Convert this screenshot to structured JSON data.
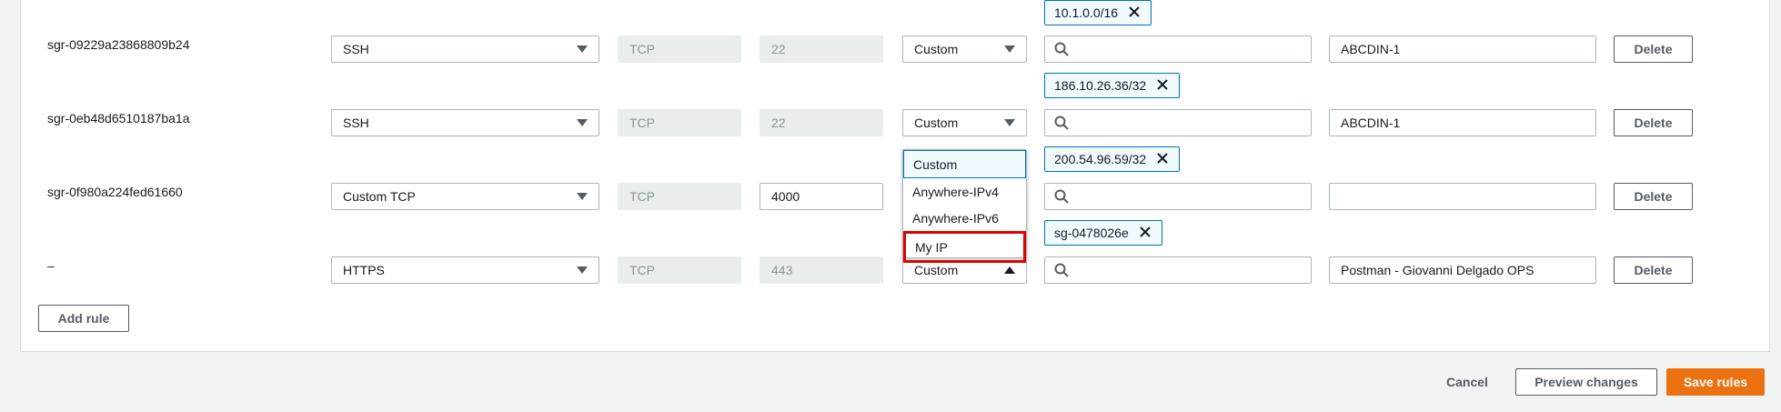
{
  "rules": [
    {
      "id": "sgr-09229a23868809b24",
      "type": "SSH",
      "protocol": "TCP",
      "port": "22",
      "source_type": "Custom",
      "token": "10.1.0.0/16",
      "description": "ABCDIN-1",
      "delete_label": "Delete"
    },
    {
      "id": "sgr-0eb48d6510187ba1a",
      "type": "SSH",
      "protocol": "TCP",
      "port": "22",
      "source_type": "Custom",
      "token": "186.10.26.36/32",
      "description": "ABCDIN-1",
      "delete_label": "Delete"
    },
    {
      "id": "sgr-0f980a224fed61660",
      "type": "Custom TCP",
      "protocol": "TCP",
      "port": "4000",
      "source_type": "Custom",
      "token": "200.54.96.59/32",
      "description": "",
      "delete_label": "Delete"
    },
    {
      "id": "–",
      "type": "HTTPS",
      "protocol": "TCP",
      "port": "443",
      "source_type": "Custom",
      "token": "sg-0478026e",
      "description": "Postman - Giovanni Delgado OPS",
      "delete_label": "Delete"
    }
  ],
  "source_dropdown": {
    "options": [
      "Custom",
      "Anywhere-IPv4",
      "Anywhere-IPv6",
      "My IP"
    ],
    "selected": "Custom",
    "highlighted": "My IP"
  },
  "actions": {
    "add_rule": "Add rule",
    "cancel": "Cancel",
    "preview": "Preview changes",
    "save": "Save rules"
  },
  "colors": {
    "primary": "#ec7211",
    "token_border": "#0073bb",
    "highlight": "#e10000"
  }
}
